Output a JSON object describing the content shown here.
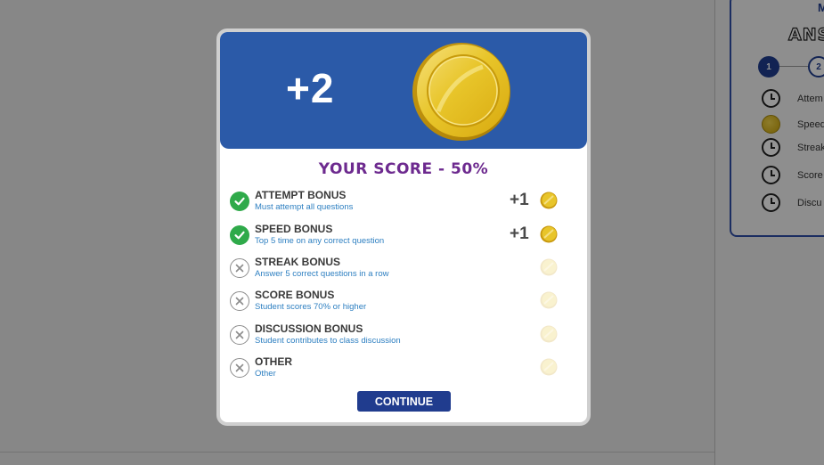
{
  "background": {
    "card_title": "M",
    "card_heading": "ANS",
    "steps": [
      "1",
      "2"
    ],
    "rows": [
      {
        "icon": "clock-icon",
        "label": "Attem"
      },
      {
        "icon": "coin-icon",
        "label": "Speed"
      },
      {
        "icon": "clock-icon",
        "label": "Streak"
      },
      {
        "icon": "clock-icon",
        "label": "Score"
      },
      {
        "icon": "clock-icon",
        "label": "Discu"
      }
    ]
  },
  "modal": {
    "award": "+2",
    "score_title": "YOUR SCORE - 50%",
    "bonuses": [
      {
        "title": "ATTEMPT BONUS",
        "desc": "Must attempt all questions",
        "earned": true,
        "points": "+1"
      },
      {
        "title": "SPEED BONUS",
        "desc": "Top 5 time on any correct question",
        "earned": true,
        "points": "+1"
      },
      {
        "title": "STREAK BONUS",
        "desc": "Answer 5 correct questions in a row",
        "earned": false,
        "points": ""
      },
      {
        "title": "SCORE BONUS",
        "desc": "Student scores 70% or higher",
        "earned": false,
        "points": ""
      },
      {
        "title": "DISCUSSION BONUS",
        "desc": "Student contributes to class discussion",
        "earned": false,
        "points": ""
      },
      {
        "title": "OTHER",
        "desc": "Other",
        "earned": false,
        "points": ""
      }
    ],
    "continue_label": "CONTINUE"
  },
  "colors": {
    "header_blue": "#2b5aa8",
    "button_blue": "#203c8e",
    "title_purple": "#6d2a8f",
    "earned_green": "#2faa4a",
    "desc_blue": "#2d7fc1",
    "coin_gold": "#e8c52a"
  }
}
